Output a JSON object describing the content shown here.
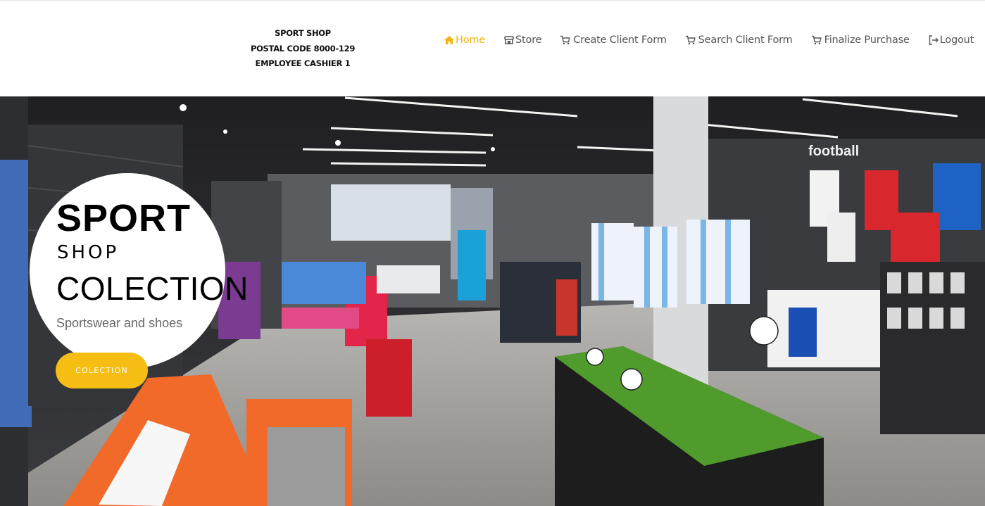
{
  "header": {
    "shop_name": "SPORT SHOP",
    "postal_code": "POSTAL CODE 8000-129",
    "employee": "EMPLOYEE CASHIER 1"
  },
  "nav": {
    "items": [
      {
        "label": "Home",
        "icon": "home-icon",
        "active": true
      },
      {
        "label": "Store",
        "icon": "store-icon",
        "active": false
      },
      {
        "label": " Create Client Form",
        "icon": "cart-icon",
        "active": false
      },
      {
        "label": "Search Client Form",
        "icon": "cart-icon",
        "active": false
      },
      {
        "label": "Finalize Purchase",
        "icon": "cart-icon",
        "active": false
      },
      {
        "label": "Logout",
        "icon": "logout-icon",
        "active": false
      }
    ],
    "active_color": "#f6b40c",
    "text_color": "#555555"
  },
  "hero": {
    "title": "SPORT",
    "subtitle": "SHOP",
    "heading": "COLECTION",
    "description": "Sportswear and shoes",
    "button_label": "COLECTION",
    "button_color": "#f6bd12",
    "background_image": "sport-store-interior",
    "store_sign": "football"
  }
}
